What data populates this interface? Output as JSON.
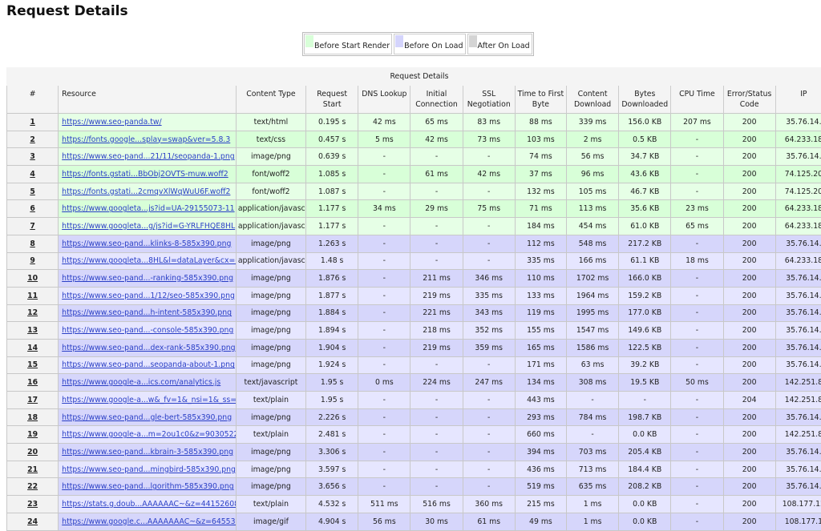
{
  "page_title": "Request Details",
  "legend": [
    {
      "label": "Before Start Render",
      "color": "#d8ffd8"
    },
    {
      "label": "Before On Load",
      "color": "#d4d4fc"
    },
    {
      "label": "After On Load",
      "color": "#d4d4d4"
    }
  ],
  "table": {
    "caption": "Request Details",
    "headers": [
      "#",
      "Resource",
      "Content Type",
      "Request Start",
      "DNS Lookup",
      "Initial Connection",
      "SSL Negotiation",
      "Time to First Byte",
      "Content Download",
      "Bytes Downloaded",
      "CPU Time",
      "Error/Status Code",
      "IP"
    ],
    "row_colors": {
      "start_render": [
        "#e6ffe6",
        "#d8ffd8"
      ],
      "on_load": [
        "#e6e6ff",
        "#d6d6fb"
      ]
    },
    "rows": [
      {
        "phase": "start_render",
        "cells": [
          "1",
          "https://www.seo-panda.tw/",
          "text/html",
          "0.195 s",
          "42 ms",
          "65 ms",
          "83 ms",
          "88 ms",
          "339 ms",
          "156.0 KB",
          "207 ms",
          "200",
          "35.76.14."
        ]
      },
      {
        "phase": "start_render",
        "cells": [
          "2",
          "https://fonts.google...splay=swap&ver=5.8.3",
          "text/css",
          "0.457 s",
          "5 ms",
          "42 ms",
          "73 ms",
          "103 ms",
          "2 ms",
          "0.5 KB",
          "-",
          "200",
          "64.233.18"
        ]
      },
      {
        "phase": "start_render",
        "cells": [
          "3",
          "https://www.seo-pand...21/11/seopanda-1.png",
          "image/png",
          "0.639 s",
          "-",
          "-",
          "-",
          "74 ms",
          "56 ms",
          "34.7 KB",
          "-",
          "200",
          "35.76.14."
        ]
      },
      {
        "phase": "start_render",
        "cells": [
          "4",
          "https://fonts.gstati...BbObj2OVTS-muw.woff2",
          "font/woff2",
          "1.085 s",
          "-",
          "61 ms",
          "42 ms",
          "37 ms",
          "96 ms",
          "43.6 KB",
          "-",
          "200",
          "74.125.20"
        ]
      },
      {
        "phase": "start_render",
        "cells": [
          "5",
          "https://fonts.gstati...2cmqvXlWqWuU6F.woff2",
          "font/woff2",
          "1.087 s",
          "-",
          "-",
          "-",
          "132 ms",
          "105 ms",
          "46.7 KB",
          "-",
          "200",
          "74.125.20"
        ]
      },
      {
        "phase": "start_render",
        "cells": [
          "6",
          "https://www.googleta...js?id=UA-29155073-11",
          "application/javascr",
          "1.177 s",
          "34 ms",
          "29 ms",
          "75 ms",
          "71 ms",
          "113 ms",
          "35.6 KB",
          "23 ms",
          "200",
          "64.233.18"
        ]
      },
      {
        "phase": "start_render",
        "cells": [
          "7",
          "https://www.googleta...g/js?id=G-YRLFHQE8HL",
          "application/javascr",
          "1.177 s",
          "-",
          "-",
          "-",
          "184 ms",
          "454 ms",
          "61.0 KB",
          "65 ms",
          "200",
          "64.233.18"
        ]
      },
      {
        "phase": "on_load",
        "cells": [
          "8",
          "https://www.seo-pand...klinks-8-585x390.png",
          "image/png",
          "1.263 s",
          "-",
          "-",
          "-",
          "112 ms",
          "548 ms",
          "217.2 KB",
          "-",
          "200",
          "35.76.14."
        ]
      },
      {
        "phase": "on_load",
        "cells": [
          "9",
          "https://www.googleta...8HL&l=dataLayer&cx=c",
          "application/javascr",
          "1.48 s",
          "-",
          "-",
          "-",
          "335 ms",
          "166 ms",
          "61.1 KB",
          "18 ms",
          "200",
          "64.233.18"
        ]
      },
      {
        "phase": "on_load",
        "cells": [
          "10",
          "https://www.seo-pand...-ranking-585x390.png",
          "image/png",
          "1.876 s",
          "-",
          "211 ms",
          "346 ms",
          "110 ms",
          "1702 ms",
          "166.0 KB",
          "-",
          "200",
          "35.76.14."
        ]
      },
      {
        "phase": "on_load",
        "cells": [
          "11",
          "https://www.seo-pand...1/12/seo-585x390.png",
          "image/png",
          "1.877 s",
          "-",
          "219 ms",
          "335 ms",
          "133 ms",
          "1964 ms",
          "159.2 KB",
          "-",
          "200",
          "35.76.14."
        ]
      },
      {
        "phase": "on_load",
        "cells": [
          "12",
          "https://www.seo-pand...h-intent-585x390.png",
          "image/png",
          "1.884 s",
          "-",
          "221 ms",
          "343 ms",
          "119 ms",
          "1995 ms",
          "177.0 KB",
          "-",
          "200",
          "35.76.14."
        ]
      },
      {
        "phase": "on_load",
        "cells": [
          "13",
          "https://www.seo-pand...-console-585x390.png",
          "image/png",
          "1.894 s",
          "-",
          "218 ms",
          "352 ms",
          "155 ms",
          "1547 ms",
          "149.6 KB",
          "-",
          "200",
          "35.76.14."
        ]
      },
      {
        "phase": "on_load",
        "cells": [
          "14",
          "https://www.seo-pand...dex-rank-585x390.png",
          "image/png",
          "1.904 s",
          "-",
          "219 ms",
          "359 ms",
          "165 ms",
          "1586 ms",
          "122.5 KB",
          "-",
          "200",
          "35.76.14."
        ]
      },
      {
        "phase": "on_load",
        "cells": [
          "15",
          "https://www.seo-pand...seopanda-about-1.png",
          "image/png",
          "1.924 s",
          "-",
          "-",
          "-",
          "171 ms",
          "63 ms",
          "39.2 KB",
          "-",
          "200",
          "35.76.14."
        ]
      },
      {
        "phase": "on_load",
        "cells": [
          "16",
          "https://www.google-a...ics.com/analytics.js",
          "text/javascript",
          "1.95 s",
          "0 ms",
          "224 ms",
          "247 ms",
          "134 ms",
          "308 ms",
          "19.5 KB",
          "50 ms",
          "200",
          "142.251.8"
        ]
      },
      {
        "phase": "on_load",
        "cells": [
          "17",
          "https://www.google-a...w&_fv=1&_nsi=1&_ss=1",
          "text/plain",
          "1.95 s",
          "-",
          "-",
          "-",
          "443 ms",
          "-",
          "-",
          "-",
          "204",
          "142.251.8"
        ]
      },
      {
        "phase": "on_load",
        "cells": [
          "18",
          "https://www.seo-pand...gle-bert-585x390.png",
          "image/png",
          "2.226 s",
          "-",
          "-",
          "-",
          "293 ms",
          "784 ms",
          "198.7 KB",
          "-",
          "200",
          "35.76.14."
        ]
      },
      {
        "phase": "on_load",
        "cells": [
          "19",
          "https://www.google-a...m=2ou1c0&z=903052222",
          "text/plain",
          "2.481 s",
          "-",
          "-",
          "-",
          "660 ms",
          "-",
          "0.0 KB",
          "-",
          "200",
          "142.251.8"
        ]
      },
      {
        "phase": "on_load",
        "cells": [
          "20",
          "https://www.seo-pand...kbrain-3-585x390.png",
          "image/png",
          "3.306 s",
          "-",
          "-",
          "-",
          "394 ms",
          "703 ms",
          "205.4 KB",
          "-",
          "200",
          "35.76.14."
        ]
      },
      {
        "phase": "on_load",
        "cells": [
          "21",
          "https://www.seo-pand...mingbird-585x390.png",
          "image/png",
          "3.597 s",
          "-",
          "-",
          "-",
          "436 ms",
          "713 ms",
          "184.4 KB",
          "-",
          "200",
          "35.76.14."
        ]
      },
      {
        "phase": "on_load",
        "cells": [
          "22",
          "https://www.seo-pand...lgorithm-585x390.png",
          "image/png",
          "3.656 s",
          "-",
          "-",
          "-",
          "519 ms",
          "635 ms",
          "208.2 KB",
          "-",
          "200",
          "35.76.14."
        ]
      },
      {
        "phase": "on_load",
        "cells": [
          "23",
          "https://stats.g.doub...AAAAAAC~&z=441526089",
          "text/plain",
          "4.532 s",
          "511 ms",
          "516 ms",
          "360 ms",
          "215 ms",
          "1 ms",
          "0.0 KB",
          "-",
          "200",
          "108.177.12"
        ]
      },
      {
        "phase": "on_load",
        "cells": [
          "24",
          "https://www.google.c...AAAAAAAC~&z=64553992",
          "image/gif",
          "4.904 s",
          "56 ms",
          "30 ms",
          "61 ms",
          "49 ms",
          "1 ms",
          "0.0 KB",
          "-",
          "200",
          "108.177.1"
        ]
      }
    ]
  }
}
